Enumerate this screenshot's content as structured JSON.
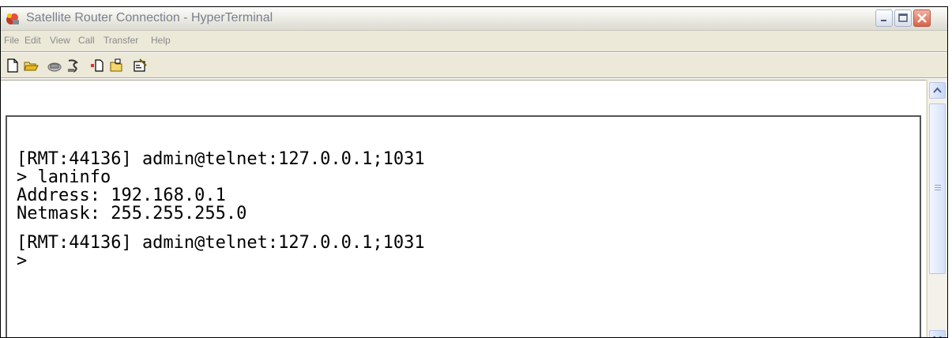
{
  "window": {
    "title": "Satellite Router Connection - HyperTerminal"
  },
  "menu": [
    "File",
    "Edit",
    "View",
    "Call",
    "Transfer",
    "Help"
  ],
  "toolbar": {
    "icons": [
      "new-document-icon",
      "open-folder-icon",
      "connect-phone-icon",
      "disconnect-phone-icon",
      "send-file-icon",
      "receive-file-icon",
      "properties-icon"
    ]
  },
  "terminal": {
    "lines": [
      "[RMT:44136] admin@telnet:127.0.0.1;1031",
      "> laninfo",
      "Address: 192.168.0.1",
      "Netmask: 255.255.255.0",
      "",
      "[RMT:44136] admin@telnet:127.0.0.1;1031",
      ">"
    ]
  },
  "colors": {
    "window_bg": "#ece9d8",
    "title_text": "#7a7f90",
    "terminal_bg": "#ffffff",
    "terminal_text": "#000000",
    "close_button": "#d9624a"
  }
}
